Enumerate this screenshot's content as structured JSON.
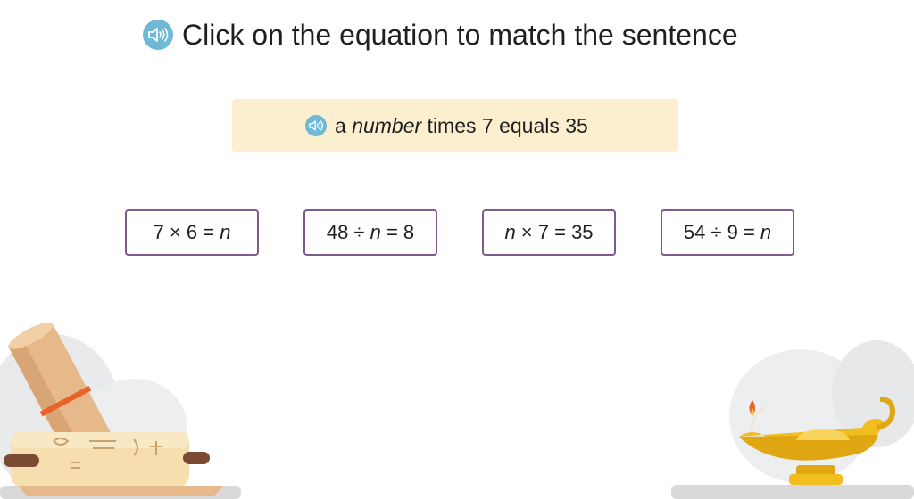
{
  "instruction": {
    "text": "Click on the equation to match the sentence",
    "speaker_icon": "speaker-icon"
  },
  "sentence": {
    "prefix": "a ",
    "emphasis": "number",
    "suffix": " times 7 equals 35",
    "speaker_icon": "speaker-icon"
  },
  "choices": [
    {
      "pre": "7 × 6 = ",
      "var": "n",
      "post": ""
    },
    {
      "pre": "48 ÷ ",
      "var": "n",
      "post": " = 8"
    },
    {
      "pre": "",
      "var": "n",
      "post": " × 7 = 35"
    },
    {
      "pre": "54 ÷ 9 = ",
      "var": "n",
      "post": ""
    }
  ],
  "decorations": {
    "left": "scroll-papyrus-illustration",
    "right": "oil-lamp-illustration"
  },
  "colors": {
    "accent": "#6fb8d6",
    "sentence_bg": "#fcefcf",
    "choice_border": "#7c5a8c"
  }
}
